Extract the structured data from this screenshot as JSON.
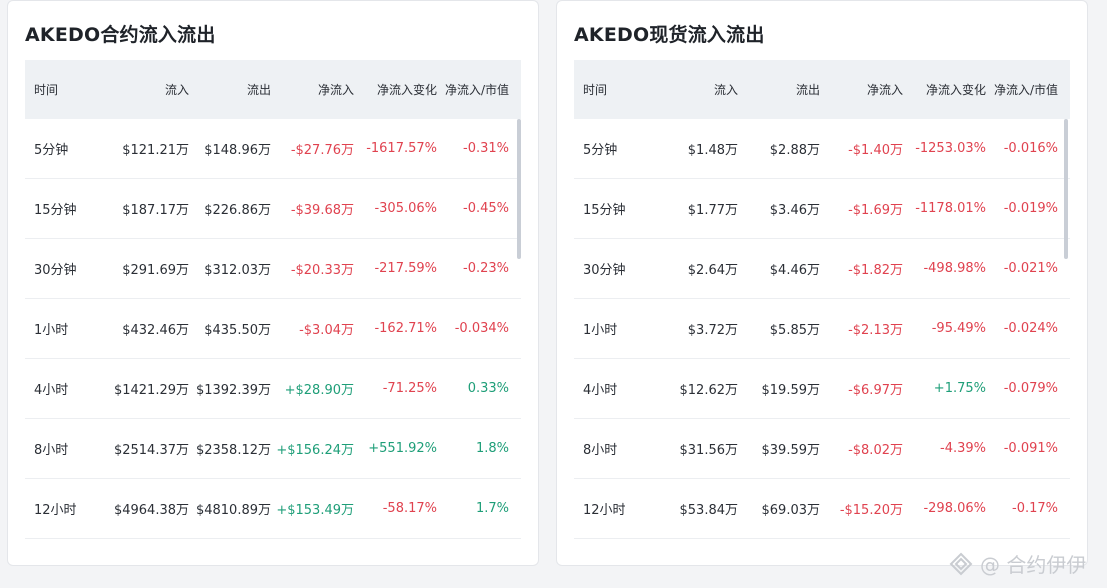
{
  "panels": [
    {
      "title": "AKEDO合约流入流出",
      "headers": [
        "时间",
        "流入",
        "流出",
        "净流入",
        "净流入变化",
        "净流入/市值"
      ],
      "rows": [
        [
          "5分钟",
          "$121.21万",
          "$148.96万",
          "-$27.76万",
          "-1617.57%",
          "-0.31%"
        ],
        [
          "15分钟",
          "$187.17万",
          "$226.86万",
          "-$39.68万",
          "-305.06%",
          "-0.45%"
        ],
        [
          "30分钟",
          "$291.69万",
          "$312.03万",
          "-$20.33万",
          "-217.59%",
          "-0.23%"
        ],
        [
          "1小时",
          "$432.46万",
          "$435.50万",
          "-$3.04万",
          "-162.71%",
          "-0.034%"
        ],
        [
          "4小时",
          "$1421.29万",
          "$1392.39万",
          "+$28.90万",
          "-71.25%",
          "0.33%"
        ],
        [
          "8小时",
          "$2514.37万",
          "$2358.12万",
          "+$156.24万",
          "+551.92%",
          "1.8%"
        ],
        [
          "12小时",
          "$4964.38万",
          "$4810.89万",
          "+$153.49万",
          "-58.17%",
          "1.7%"
        ]
      ]
    },
    {
      "title": "AKEDO现货流入流出",
      "headers": [
        "时间",
        "流入",
        "流出",
        "净流入",
        "净流入变化",
        "净流入/市值"
      ],
      "rows": [
        [
          "5分钟",
          "$1.48万",
          "$2.88万",
          "-$1.40万",
          "-1253.03%",
          "-0.016%"
        ],
        [
          "15分钟",
          "$1.77万",
          "$3.46万",
          "-$1.69万",
          "-1178.01%",
          "-0.019%"
        ],
        [
          "30分钟",
          "$2.64万",
          "$4.46万",
          "-$1.82万",
          "-498.98%",
          "-0.021%"
        ],
        [
          "1小时",
          "$3.72万",
          "$5.85万",
          "-$2.13万",
          "-95.49%",
          "-0.024%"
        ],
        [
          "4小时",
          "$12.62万",
          "$19.59万",
          "-$6.97万",
          "+1.75%",
          "-0.079%"
        ],
        [
          "8小时",
          "$31.56万",
          "$39.59万",
          "-$8.02万",
          "-4.39%",
          "-0.091%"
        ],
        [
          "12小时",
          "$53.84万",
          "$69.03万",
          "-$15.20万",
          "-298.06%",
          "-0.17%"
        ]
      ]
    }
  ],
  "colors": {
    "negative": "#e0424f",
    "positive": "#1e9e78"
  },
  "watermark": {
    "text": "@ 合约伊伊",
    "icon": "logo-icon"
  }
}
